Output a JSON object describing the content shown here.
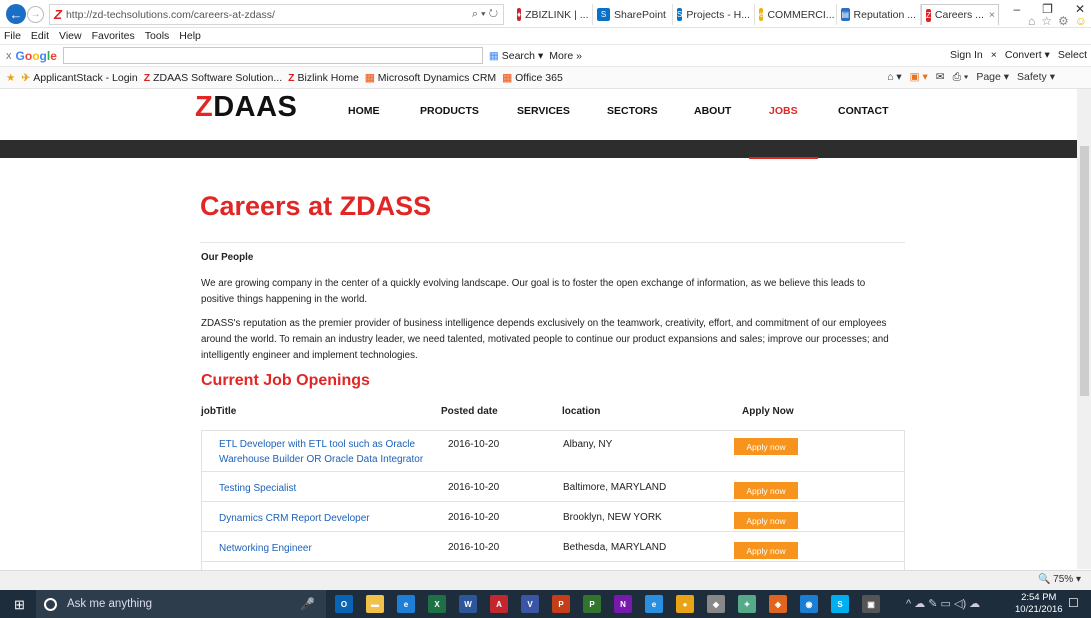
{
  "browser": {
    "url": "http://zd-techsolutions.com/careers-at-zdass/",
    "addr_controls": "⌕ ▾ ↻",
    "tabs": [
      {
        "label": "ZBIZLINK | ...",
        "icon": "♦",
        "color": "#c23"
      },
      {
        "label": "SharePoint",
        "icon": "S",
        "color": "#0a72c6"
      },
      {
        "label": "Projects - H...",
        "icon": "S",
        "color": "#0a72c6"
      },
      {
        "label": "COMMERCI...",
        "icon": "e",
        "color": "#f2b000"
      },
      {
        "label": "Reputation ...",
        "icon": "▤",
        "color": "#2a6fc9"
      },
      {
        "label": "Careers ...",
        "icon": "Z",
        "color": "#d22"
      }
    ],
    "tab_close": "×",
    "window_controls": [
      "–",
      "❐",
      "✕"
    ],
    "title_icons": [
      "⌂",
      "☆",
      "⚙",
      "☺"
    ],
    "menu": [
      "File",
      "Edit",
      "View",
      "Favorites",
      "Tools",
      "Help"
    ],
    "google_toolbar": {
      "close": "x",
      "logo": "Google",
      "search_label": "Search",
      "more_label": "More »",
      "right": [
        "Sign In",
        "×",
        "Convert ▾",
        "Select"
      ]
    },
    "favorites": [
      {
        "label": "ApplicantStack - Login",
        "icon": "✈"
      },
      {
        "label": "ZDAAS Software Solution...",
        "icon": "Z"
      },
      {
        "label": "Bizlink Home",
        "icon": "Z"
      },
      {
        "label": "Microsoft Dynamics CRM",
        "icon": "▦"
      },
      {
        "label": "Office 365",
        "icon": "▦"
      }
    ],
    "fav_star": "★",
    "fav_right": [
      "⌂ ▾",
      "▣ ▾",
      "✉",
      "⎙ ▾",
      "Page ▾",
      "Safety ▾"
    ],
    "zoom": "🔍 75%  ▾"
  },
  "site": {
    "logo_z": "Z",
    "logo_rest": "DAAS",
    "nav": [
      "HOME",
      "PRODUCTS",
      "SERVICES",
      "SECTORS",
      "ABOUT",
      "JOBS",
      "CONTACT"
    ],
    "active_nav": "JOBS",
    "page_title": "Careers at ZDASS",
    "our_people_heading": "Our People",
    "para1": "We are growing company in the center of a quickly evolving landscape. Our goal is to foster the open exchange of information, as we believe this leads to positive things happening in the world.",
    "para2": "ZDASS's reputation as the premier provider of business intelligence depends exclusively on the teamwork, creativity, effort, and commitment of our  employees around the world. To remain an industry leader, we need talented, motivated people to continue our product expansions and sales; improve our processes; and intelligently engineer and implement technologies.",
    "openings_heading": "Current Job Openings",
    "columns": [
      "jobTitle",
      "Posted date",
      "location",
      "Apply Now"
    ],
    "jobs": [
      {
        "title": "ETL Developer with ETL tool such as Oracle Warehouse Builder OR Oracle Data Integrator",
        "date": "2016-10-20",
        "location": "Albany, NY",
        "apply": "Apply now"
      },
      {
        "title": "Testing Specialist",
        "date": "2016-10-20",
        "location": "Baltimore, MARYLAND",
        "apply": "Apply now"
      },
      {
        "title": "Dynamics CRM Report Developer",
        "date": "2016-10-20",
        "location": "Brooklyn, NEW YORK",
        "apply": "Apply now"
      },
      {
        "title": "Networking Engineer",
        "date": "2016-10-20",
        "location": "Bethesda, MARYLAND",
        "apply": "Apply now"
      }
    ],
    "accent_color": "#e12726",
    "button_color": "#f7941d",
    "link_color": "#1c62b9"
  },
  "taskbar": {
    "start": "⊞",
    "search_placeholder": "Ask me anything",
    "mic": "🎤",
    "apps": [
      {
        "name": "outlook",
        "label": "O",
        "color": "#0a64b4"
      },
      {
        "name": "explorer",
        "label": "▬",
        "color": "#f0c24b"
      },
      {
        "name": "edge",
        "label": "e",
        "color": "#1e7fd6"
      },
      {
        "name": "excel",
        "label": "X",
        "color": "#1e7145"
      },
      {
        "name": "word",
        "label": "W",
        "color": "#2b579a"
      },
      {
        "name": "acrobat",
        "label": "A",
        "color": "#c1272d"
      },
      {
        "name": "visio",
        "label": "V",
        "color": "#3955a3"
      },
      {
        "name": "powerpoint",
        "label": "P",
        "color": "#c43e1c"
      },
      {
        "name": "project",
        "label": "P",
        "color": "#31752f"
      },
      {
        "name": "onenote",
        "label": "N",
        "color": "#7719aa"
      },
      {
        "name": "ie",
        "label": "e",
        "color": "#2b8fe0"
      },
      {
        "name": "chrome",
        "label": "●",
        "color": "#e8a317"
      },
      {
        "name": "app-1",
        "label": "◆",
        "color": "#888"
      },
      {
        "name": "app-2",
        "label": "✦",
        "color": "#5a8"
      },
      {
        "name": "app-3",
        "label": "◈",
        "color": "#e0641e"
      },
      {
        "name": "app-4",
        "label": "◉",
        "color": "#1a7fd4"
      },
      {
        "name": "skype",
        "label": "S",
        "color": "#00aff0"
      },
      {
        "name": "store",
        "label": "▣",
        "color": "#555"
      }
    ],
    "tray": "^ ☁ ✎ ▭ ◁) ☁",
    "time": "2:54 PM",
    "date": "10/21/2016",
    "notifications": "☐"
  }
}
